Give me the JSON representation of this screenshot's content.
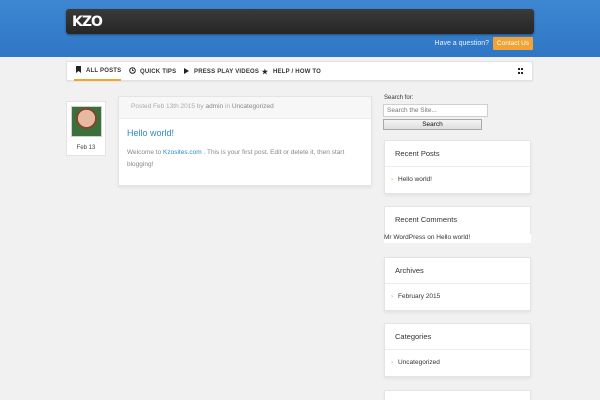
{
  "header": {
    "logo_text": "KZO",
    "question": "Have a question?",
    "contact_label": "Contact Us"
  },
  "nav": {
    "items": [
      {
        "label": "ALL POSTS",
        "icon": "bookmark-icon"
      },
      {
        "label": "QUICK TIPS",
        "icon": "clock-icon"
      },
      {
        "label": "PRESS PLAY VIDEOS",
        "icon": "play-icon"
      },
      {
        "label": "HELP / HOW TO",
        "icon": "star-icon"
      }
    ],
    "menu_icon": "grid-icon"
  },
  "post": {
    "date_badge": "Feb 13",
    "meta_prefix": "Posted Feb 13th 2015 by ",
    "meta_author": "admin",
    "meta_in": " in ",
    "meta_category": "Uncategorized",
    "title": "Hello world!",
    "body_prefix": "Welcome to ",
    "body_link": "Kzosites.com",
    "body_suffix": " . This is your first post. Edit or delete it, then start blogging!"
  },
  "sidebar": {
    "search_label": "Search for:",
    "search_placeholder": "Search the Site...",
    "search_button": "Search",
    "recent_posts": {
      "title": "Recent Posts",
      "items": [
        "Hello world!"
      ]
    },
    "recent_comments": {
      "title": "Recent Comments",
      "line": "Mr WordPress on Hello world!"
    },
    "archives": {
      "title": "Archives",
      "items": [
        "February 2015"
      ]
    },
    "categories": {
      "title": "Categories",
      "items": [
        "Uncategorized"
      ]
    }
  }
}
